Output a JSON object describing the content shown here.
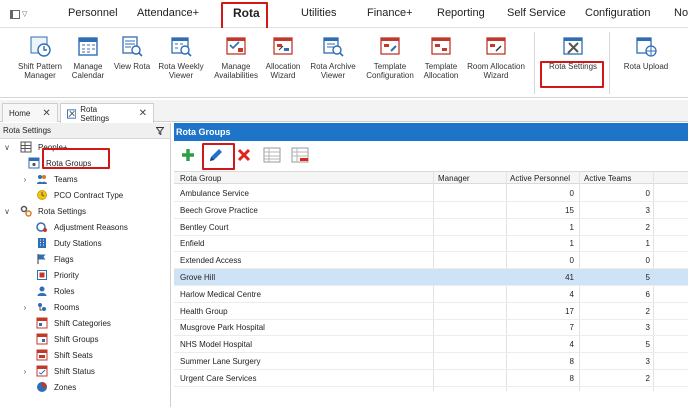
{
  "menubar": {
    "items": [
      "Personnel",
      "Attendance+",
      "Rota",
      "Utilities",
      "Finance+",
      "Reporting",
      "Self Service",
      "Configuration",
      "Not"
    ],
    "active": "Rota"
  },
  "ribbon": {
    "buttons": [
      "Shift Pattern\nManager",
      "Manage\nCalendar",
      "View Rota",
      "Rota Weekly\nViewer",
      "Manage\nAvailabilities",
      "Allocation\nWizard",
      "Rota Archive\nViewer",
      "Template\nConfiguration",
      "Template\nAllocation",
      "Room Allocation\nWizard",
      "Rota Settings",
      "Rota Upload"
    ]
  },
  "tabs": {
    "home": "Home",
    "rota_settings": "Rota Settings",
    "close": "✕"
  },
  "tree": {
    "header": "Rota Settings",
    "filter_icon": "filter-icon",
    "people_plus": "People+",
    "rota_groups": "Rota Groups",
    "teams": "Teams",
    "pco_contract_type": "PCO Contract Type",
    "rota_settings": "Rota Settings",
    "children": [
      "Adjustment Reasons",
      "Duty Stations",
      "Flags",
      "Priority",
      "Roles",
      "Rooms",
      "Shift Categories",
      "Shift Groups",
      "Shift Seats",
      "Shift Status",
      "Zones"
    ]
  },
  "main": {
    "title": "Rota Groups",
    "columns": [
      "Rota Group",
      "Manager",
      "Active Personnel",
      "Active Teams"
    ],
    "rows": [
      {
        "name": "Ambulance Service",
        "manager": "",
        "personnel": "0",
        "teams": "0"
      },
      {
        "name": "Beech Grove Practice",
        "manager": "",
        "personnel": "15",
        "teams": "3"
      },
      {
        "name": "Bentley Court",
        "manager": "",
        "personnel": "1",
        "teams": "2"
      },
      {
        "name": "Enfield",
        "manager": "",
        "personnel": "1",
        "teams": "1"
      },
      {
        "name": "Extended Access",
        "manager": "",
        "personnel": "0",
        "teams": "0"
      },
      {
        "name": "Grove Hill",
        "manager": "",
        "personnel": "41",
        "teams": "5"
      },
      {
        "name": "Harlow Medical Centre",
        "manager": "",
        "personnel": "4",
        "teams": "6"
      },
      {
        "name": "Health Group",
        "manager": "",
        "personnel": "17",
        "teams": "2"
      },
      {
        "name": "Musgrove Park Hospital",
        "manager": "",
        "personnel": "7",
        "teams": "3"
      },
      {
        "name": "NHS Model Hospital",
        "manager": "",
        "personnel": "4",
        "teams": "5"
      },
      {
        "name": "Summer Lane Surgery",
        "manager": "",
        "personnel": "8",
        "teams": "3"
      },
      {
        "name": "Urgent Care Services",
        "manager": "",
        "personnel": "8",
        "teams": "2"
      }
    ],
    "selected_row": "Grove Hill"
  },
  "colors": {
    "accent": "#1e74c8",
    "highlight": "#d11818",
    "selected_row": "#cfe3f7"
  }
}
